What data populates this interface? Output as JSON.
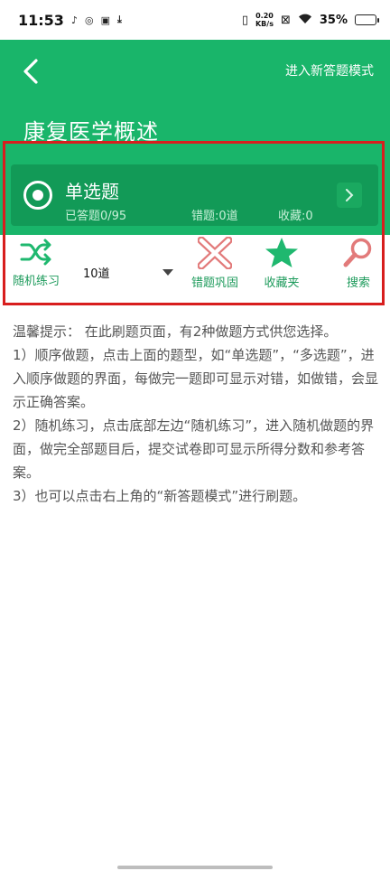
{
  "status_bar": {
    "time": "11:53",
    "net_speed_value": "0.20",
    "net_speed_unit": "KB/s",
    "battery": "35%",
    "battery_level": 0.35
  },
  "header": {
    "title": "康复医学概述",
    "action_label": "进入新答题模式"
  },
  "question_type": {
    "name": "单选题",
    "answered": "已答题0/95",
    "wrong": "错题:0道",
    "favorites": "收藏:0"
  },
  "toolbar": {
    "random_label": "随机练习",
    "count_value": "10道",
    "wrong_review_label": "错题巩固",
    "favorites_label": "收藏夹",
    "search_label": "搜索"
  },
  "tips": {
    "intro": "温馨提示： 在此刷题页面，有2种做题方式供您选择。",
    "item1": " 1）顺序做题，点击上面的题型，如“单选题”，“多选题”，进入顺序做题的界面，每做完一题即可显示对错，如做错，会显示正确答案。",
    "item2": " 2）随机练习，点击底部左边“随机练习”，进入随机做题的界面，做完全部题目后，提交试卷即可显示所得分数和参考答案。",
    "item3": " 3）也可以点击右上角的“新答题模式”进行刷题。"
  },
  "colors": {
    "brand_green": "#19b56a",
    "card_green": "#129a57",
    "highlight_red": "#d81e1e",
    "wrong_icon": "#e27a7a",
    "search_icon": "#e27a7a"
  }
}
